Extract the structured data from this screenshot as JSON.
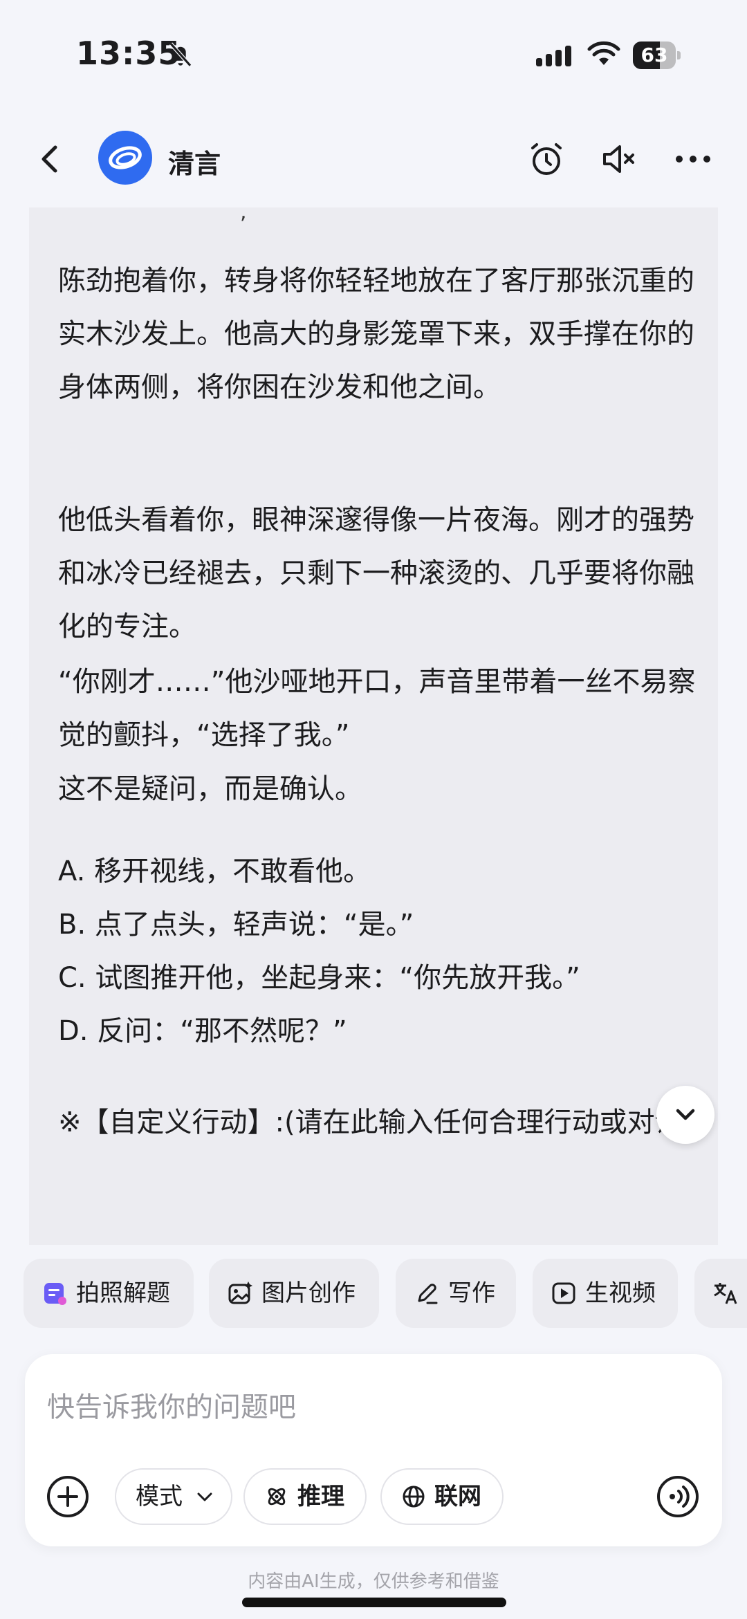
{
  "status_bar": {
    "time": "13:35",
    "battery": "63",
    "battery_level": 0.63
  },
  "header": {
    "title": "清言"
  },
  "chat": {
    "paragraphs": [
      "陈劲抱着你，转身将你轻轻地放在了客厅那张沉重的实木沙发上。他高大的身影笼罩下来，双手撑在你的身体两侧，将你困在沙发和他之间。",
      "他低头看着你，眼神深邃得像一片夜海。刚才的强势和冰冷已经褪去，只剩下一种滚烫的、几乎要将你融化的专注。",
      "“你刚才……”他沙哑地开口，声音里带着一丝不易察觉的颤抖，“选择了我。”",
      "这不是疑问，而是确认。"
    ],
    "options": [
      "A. 移开视线，不敢看他。",
      "B. 点了点头，轻声说：“是。”",
      "C. 试图推开他，坐起身来：“你先放开我。”",
      "D. 反问：“那不然呢？”"
    ],
    "custom_action": "※【自定义行动】:(请在此输入任何合理行动或对话)"
  },
  "quick_actions": [
    {
      "label": "拍照解题",
      "icon": "photo-solve-icon"
    },
    {
      "label": "图片创作",
      "icon": "image-create-icon"
    },
    {
      "label": "写作",
      "icon": "pen-icon"
    },
    {
      "label": "生视频",
      "icon": "video-icon"
    },
    {
      "label": "",
      "icon": "translate-icon"
    }
  ],
  "input": {
    "placeholder": "快告诉我你的问题吧",
    "mode_label": "模式",
    "reasoning_label": "推理",
    "web_label": "联网"
  },
  "footer": {
    "disclaimer": "内容由AI生成，仅供参考和借鉴"
  },
  "colors": {
    "accent": "#2f6bf0",
    "background": "#f4f5fa",
    "card": "#ececf1",
    "chip_purple": "#6a5cf5"
  }
}
